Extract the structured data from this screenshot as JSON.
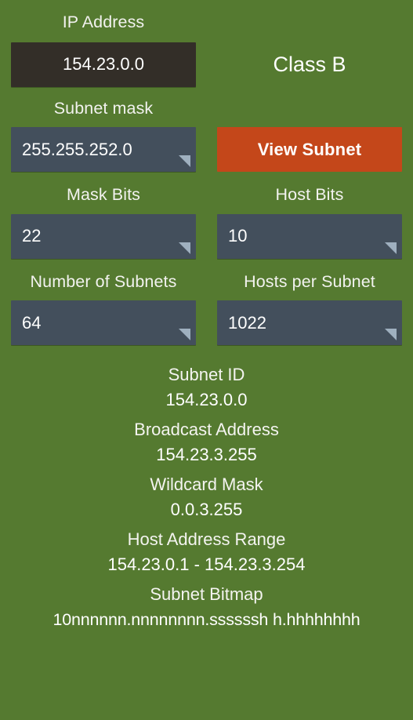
{
  "theme": {
    "background": "#557a30",
    "edit_box_bg": "#332e28",
    "spinner_bg": "#434f5c",
    "action_bg": "#c4471a",
    "text": "#ffffff",
    "caret": "#9fb0bf"
  },
  "fields": {
    "ip_address": {
      "label": "IP Address",
      "value": "154.23.0.0"
    },
    "subnet_mask": {
      "label": "Subnet mask",
      "value": "255.255.252.0"
    },
    "mask_bits": {
      "label": "Mask Bits",
      "value": "22"
    },
    "host_bits": {
      "label": "Host Bits",
      "value": "10"
    },
    "number_of_subnets": {
      "label": "Number of Subnets",
      "value": "64"
    },
    "hosts_per_subnet": {
      "label": "Hosts per Subnet",
      "value": "1022"
    }
  },
  "class_indicator": {
    "value": "Class B"
  },
  "actions": {
    "view_subnet": "View Subnet"
  },
  "results": [
    {
      "title": "Subnet ID",
      "value": "154.23.0.0"
    },
    {
      "title": "Broadcast Address",
      "value": "154.23.3.255"
    },
    {
      "title": "Wildcard Mask",
      "value": "0.0.3.255"
    },
    {
      "title": "Host Address Range",
      "value": "154.23.0.1 - 154.23.3.254"
    },
    {
      "title": "Subnet Bitmap",
      "value": "10nnnnnn.nnnnnnnn.ssssssh h.hhhhhhhh"
    }
  ]
}
